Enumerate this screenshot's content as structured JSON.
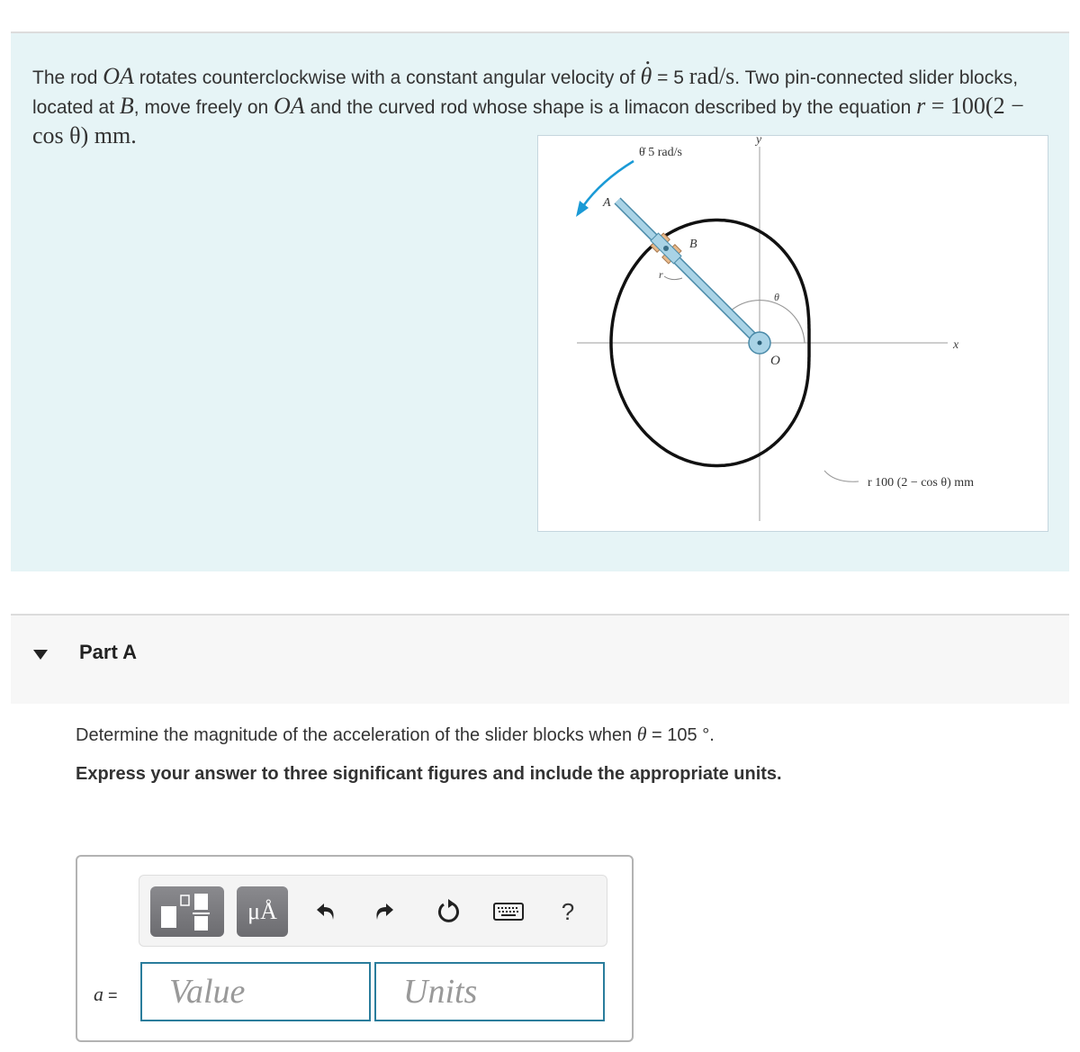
{
  "problem": {
    "text_part1": "The rod ",
    "rod_name": "OA",
    "text_part2": " rotates counterclockwise with a constant angular velocity of ",
    "theta_symbol": "θ",
    "text_part3": " = 5 ",
    "velocity_unit": "rad/s",
    "text_part4": ". Two pin-connected slider blocks, located at ",
    "point_b": "B",
    "text_part5": ", move freely on ",
    "rod_name_2": "OA",
    "text_part6": " and the curved rod whose shape is a limacon described by the equation ",
    "equation_r": "r",
    "equation_rest": " = 100(2 − cos θ) mm",
    "text_end": "."
  },
  "figure": {
    "angular_velocity_label": "θ̇  5 rad/s",
    "label_A": "A",
    "label_B": "B",
    "label_r": "r",
    "label_theta": "θ",
    "label_O": "O",
    "axis_x": "x",
    "axis_y": "y",
    "curve_label": "r  100 (2 − cos θ) mm",
    "colors": {
      "rod": "#a9d3e6",
      "rod_outline": "#4a8aa8",
      "slider": "#e8b98a",
      "arrow": "#1a9ad6",
      "curve": "#111111",
      "axis": "#bdbdbd"
    }
  },
  "part": {
    "title": "Part A",
    "question_prefix": "Determine the magnitude of the acceleration of the slider blocks when ",
    "question_theta": "θ",
    "question_value": " = 105 °.",
    "instruction": "Express your answer to three significant figures and include the appropriate units."
  },
  "toolbar": {
    "templates_icon": "fraction-templates-icon",
    "units_label": "μÅ",
    "undo": "undo-icon",
    "redo": "redo-icon",
    "reset": "reset-icon",
    "keyboard": "keyboard-icon",
    "help_label": "?"
  },
  "answer": {
    "variable": "a",
    "equals": " =",
    "value_placeholder": "Value",
    "units_placeholder": "Units",
    "accent": "#2a7d9c"
  }
}
